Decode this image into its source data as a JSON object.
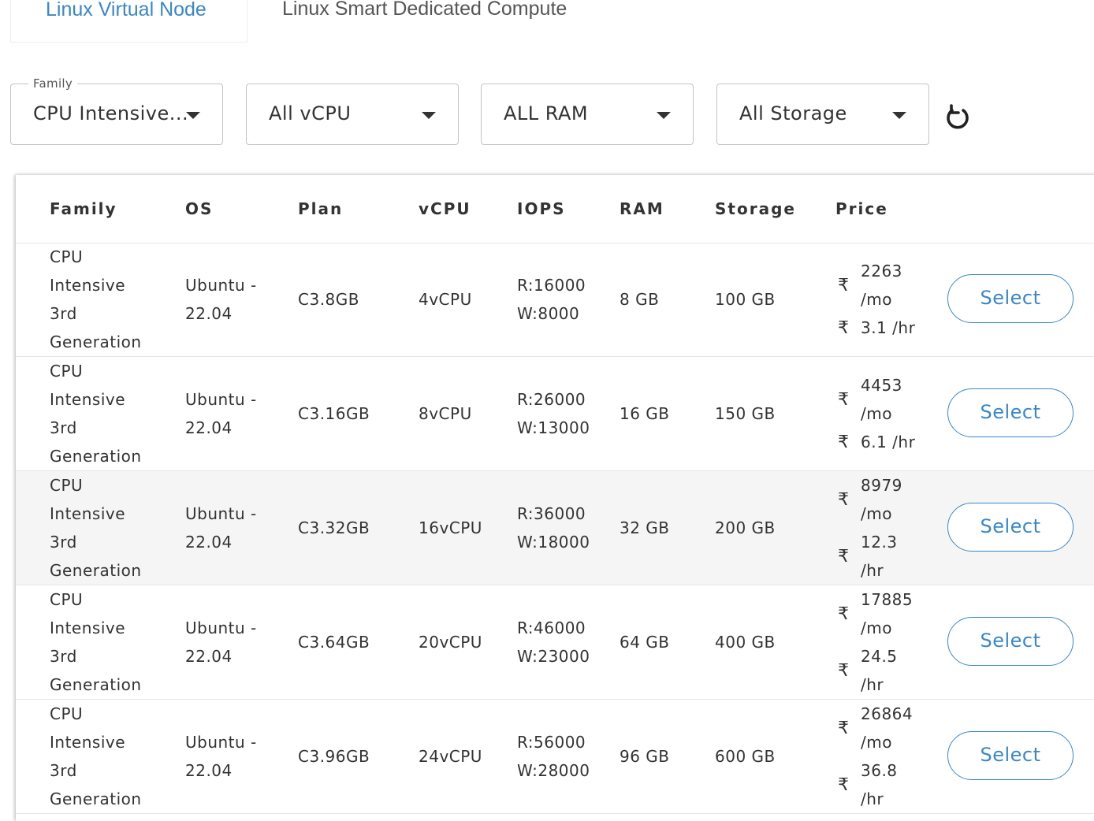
{
  "tabs": [
    {
      "label": "Linux Virtual Node",
      "active": true
    },
    {
      "label": "Linux Smart Dedicated Compute",
      "active": false
    }
  ],
  "filters": {
    "family": {
      "legend": "Family",
      "value": "CPU Intensive..."
    },
    "vcpu": {
      "value": "All vCPU"
    },
    "ram": {
      "value": "ALL RAM"
    },
    "storage": {
      "value": "All Storage"
    }
  },
  "refresh_icon": "refresh-icon",
  "accent_color": "#3a87c8",
  "table": {
    "headers": [
      "Family",
      "OS",
      "Plan",
      "vCPU",
      "IOPS",
      "RAM",
      "Storage",
      "Price"
    ],
    "currency_symbol": "₹",
    "select_label": "Select",
    "rows": [
      {
        "family": [
          "CPU",
          "Intensive",
          "3rd",
          "Generation"
        ],
        "os": [
          "Ubuntu -",
          "22.04"
        ],
        "plan": "C3.8GB",
        "vcpu": "4vCPU",
        "iops": [
          "R:16000",
          "W:8000"
        ],
        "ram": "8 GB",
        "storage": "100 GB",
        "price_mo": [
          "2263",
          "/mo"
        ],
        "price_hr": [
          "3.1 /hr"
        ],
        "highlight": false
      },
      {
        "family": [
          "CPU",
          "Intensive",
          "3rd",
          "Generation"
        ],
        "os": [
          "Ubuntu -",
          "22.04"
        ],
        "plan": "C3.16GB",
        "vcpu": "8vCPU",
        "iops": [
          "R:26000",
          "W:13000"
        ],
        "ram": "16 GB",
        "storage": "150 GB",
        "price_mo": [
          "4453",
          "/mo"
        ],
        "price_hr": [
          "6.1 /hr"
        ],
        "highlight": false
      },
      {
        "family": [
          "CPU",
          "Intensive",
          "3rd",
          "Generation"
        ],
        "os": [
          "Ubuntu -",
          "22.04"
        ],
        "plan": "C3.32GB",
        "vcpu": "16vCPU",
        "iops": [
          "R:36000",
          "W:18000"
        ],
        "ram": "32 GB",
        "storage": "200 GB",
        "price_mo": [
          "8979",
          "/mo"
        ],
        "price_hr": [
          "12.3",
          "/hr"
        ],
        "highlight": true
      },
      {
        "family": [
          "CPU",
          "Intensive",
          "3rd",
          "Generation"
        ],
        "os": [
          "Ubuntu -",
          "22.04"
        ],
        "plan": "C3.64GB",
        "vcpu": "20vCPU",
        "iops": [
          "R:46000",
          "W:23000"
        ],
        "ram": "64 GB",
        "storage": "400 GB",
        "price_mo": [
          "17885",
          "/mo"
        ],
        "price_hr": [
          "24.5",
          "/hr"
        ],
        "highlight": false
      },
      {
        "family": [
          "CPU",
          "Intensive",
          "3rd",
          "Generation"
        ],
        "os": [
          "Ubuntu -",
          "22.04"
        ],
        "plan": "C3.96GB",
        "vcpu": "24vCPU",
        "iops": [
          "R:56000",
          "W:28000"
        ],
        "ram": "96 GB",
        "storage": "600 GB",
        "price_mo": [
          "26864",
          "/mo"
        ],
        "price_hr": [
          "36.8",
          "/hr"
        ],
        "highlight": false
      }
    ]
  }
}
